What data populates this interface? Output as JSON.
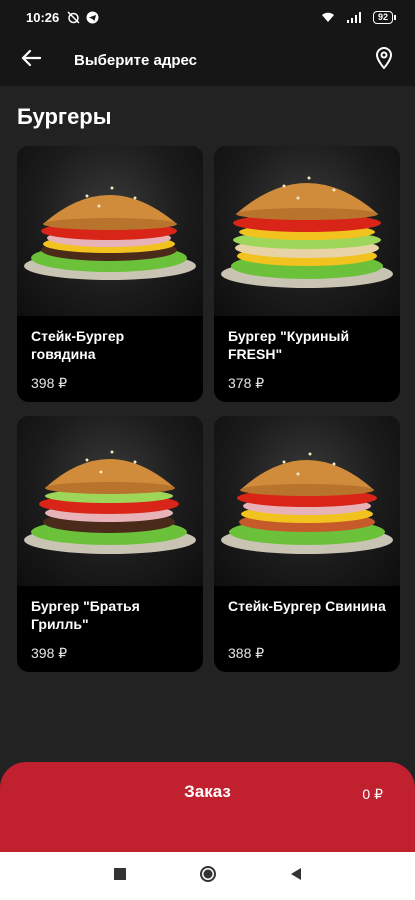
{
  "status_bar": {
    "time": "10:26",
    "battery": "92",
    "icons": [
      "alarm-off-icon",
      "telegram-icon",
      "wifi-icon",
      "signal-icon",
      "battery-icon"
    ]
  },
  "header": {
    "back_icon": "arrow-left-icon",
    "address": "Выберите адрес",
    "location_icon": "map-pin-icon"
  },
  "section": {
    "title": "Бургеры"
  },
  "products": [
    {
      "name": "Стейк-Бургер говядина",
      "price": "398 ₽"
    },
    {
      "name": "Бургер \"Куриный FRESH\"",
      "price": "378 ₽"
    },
    {
      "name": "Бургер \"Братья Грилль\"",
      "price": "398 ₽"
    },
    {
      "name": "Стейк-Бургер Свинина",
      "price": "388 ₽"
    }
  ],
  "order": {
    "label": "Заказ",
    "total": "0 ₽"
  },
  "nav": {
    "icons": [
      "recents-square-icon",
      "home-circle-icon",
      "back-triangle-icon"
    ]
  },
  "colors": {
    "background": "#222222",
    "card": "#000000",
    "accent": "#c1202f"
  }
}
